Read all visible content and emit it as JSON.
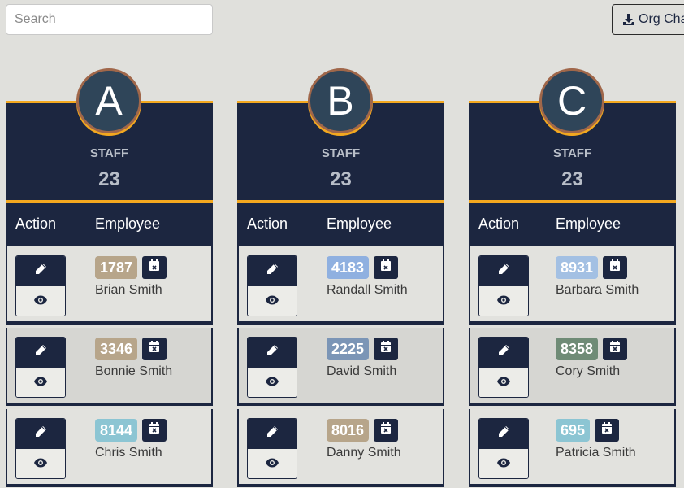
{
  "search": {
    "placeholder": "Search"
  },
  "org_button": {
    "label": "Org Chart"
  },
  "labels": {
    "staff": "STAFF",
    "action": "Action",
    "employee": "Employee"
  },
  "colors": {
    "navy": "#1c2640",
    "accent": "#f3a81f",
    "circle": "#2f4559",
    "circle_border": "#a0674a"
  },
  "columns": [
    {
      "letter": "A",
      "count": "23",
      "rows": [
        {
          "id": "1787",
          "color": "#b7a58a",
          "name": "Brian Smith"
        },
        {
          "id": "3346",
          "color": "#b7a58a",
          "name": "Bonnie Smith"
        },
        {
          "id": "8144",
          "color": "#8cc5d3",
          "name": "Chris Smith"
        }
      ]
    },
    {
      "letter": "B",
      "count": "23",
      "rows": [
        {
          "id": "4183",
          "color": "#8fb0e0",
          "name": "Randall Smith"
        },
        {
          "id": "2225",
          "color": "#7b95b6",
          "name": "David Smith"
        },
        {
          "id": "8016",
          "color": "#b7a58a",
          "name": "Danny Smith"
        }
      ]
    },
    {
      "letter": "C",
      "count": "23",
      "rows": [
        {
          "id": "8931",
          "color": "#a3c0e3",
          "name": "Barbara Smith"
        },
        {
          "id": "8358",
          "color": "#6f8b76",
          "name": "Cory Smith"
        },
        {
          "id": "695",
          "color": "#8cc5d3",
          "name": "Patricia Smith"
        }
      ]
    }
  ]
}
